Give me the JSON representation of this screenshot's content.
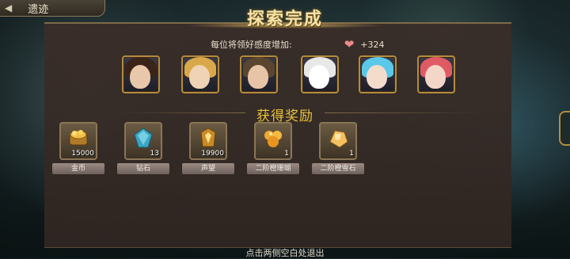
{
  "back_tab": {
    "label": "遗迹"
  },
  "panel": {
    "title": "探索完成",
    "affinity_text": "每位将领好感度增加:",
    "affinity_value": "+324"
  },
  "portraits": [
    {
      "hair": "#3a2418",
      "skin": "#e8c7aa"
    },
    {
      "hair": "#d9a84a",
      "skin": "#f0d2b4"
    },
    {
      "hair": "#5a4630",
      "skin": "#e6c5a6"
    },
    {
      "hair": "#e8e8e8",
      "skin": "#ffffff"
    },
    {
      "hair": "#5ac8e8",
      "skin": "#f4dccc"
    },
    {
      "hair": "#e05a64",
      "skin": "#f4d6c8"
    }
  ],
  "reward": {
    "title": "获得奖励",
    "items": [
      {
        "name": "金币",
        "count": "15000",
        "color": "#d9a030",
        "icon": "gold-coin-icon"
      },
      {
        "name": "钻石",
        "count": "13",
        "color": "#4fb0c8",
        "icon": "diamond-icon"
      },
      {
        "name": "声望",
        "count": "19900",
        "color": "#d7a035",
        "icon": "prestige-icon"
      },
      {
        "name": "二阶橙珊瑚",
        "count": "1",
        "color": "#f0a830",
        "icon": "orange-coral-icon"
      },
      {
        "name": "二阶橙雪石",
        "count": "1",
        "color": "#f5c060",
        "icon": "orange-snowstone-icon"
      }
    ]
  },
  "exit_hint": "点击两侧空白处退出"
}
